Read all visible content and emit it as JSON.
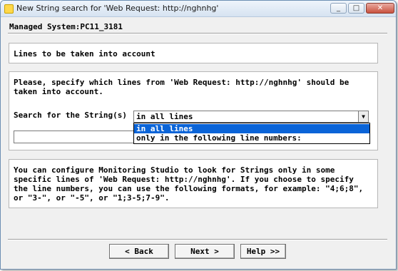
{
  "window": {
    "title": "New String search for 'Web Request: http://nghnhg'",
    "controls": [
      "_",
      "□",
      "✕"
    ]
  },
  "header": {
    "managed_system": "Managed System:PC11_3181"
  },
  "section": {
    "title": "Lines to be taken into account"
  },
  "form": {
    "instruction_line1": "Please, specify which lines from 'Web Request: http://nghnhg' should be",
    "instruction_line2": "taken into account.",
    "search_label": "Search for the String(s)",
    "selected_value": "in all lines",
    "options": [
      "in all lines",
      "only in the following line numbers:"
    ],
    "line_numbers_value": ""
  },
  "help": {
    "line1": "You can configure Monitoring Studio to look for Strings only in some",
    "line2": "specific lines of 'Web Request: http://nghnhg'. If you choose to specify",
    "line3": "the line numbers, you can use the following formats, for example: \"4;6;8\",",
    "line4": "or \"3-\", or \"-5\", or \"1;3-5;7-9\"."
  },
  "buttons": {
    "back": "< Back",
    "next": "Next >",
    "help": "Help >>"
  }
}
